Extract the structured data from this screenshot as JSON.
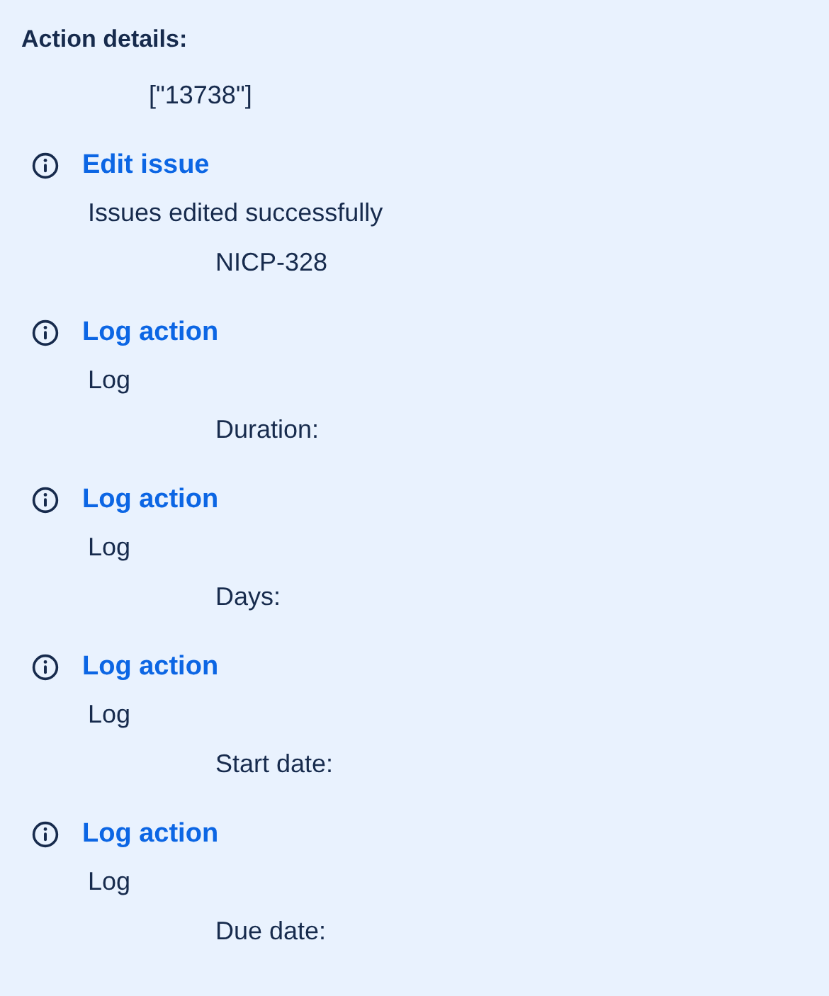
{
  "header": "Action details:",
  "header_value": "[\"13738\"]",
  "actions": [
    {
      "title": "Edit issue",
      "message": "Issues edited successfully",
      "detail": "NICP-328"
    },
    {
      "title": "Log action",
      "message": "Log",
      "detail": "Duration:"
    },
    {
      "title": "Log action",
      "message": "Log",
      "detail": "Days:"
    },
    {
      "title": "Log action",
      "message": "Log",
      "detail": "Start date:"
    },
    {
      "title": "Log action",
      "message": "Log",
      "detail": "Due date:"
    }
  ]
}
